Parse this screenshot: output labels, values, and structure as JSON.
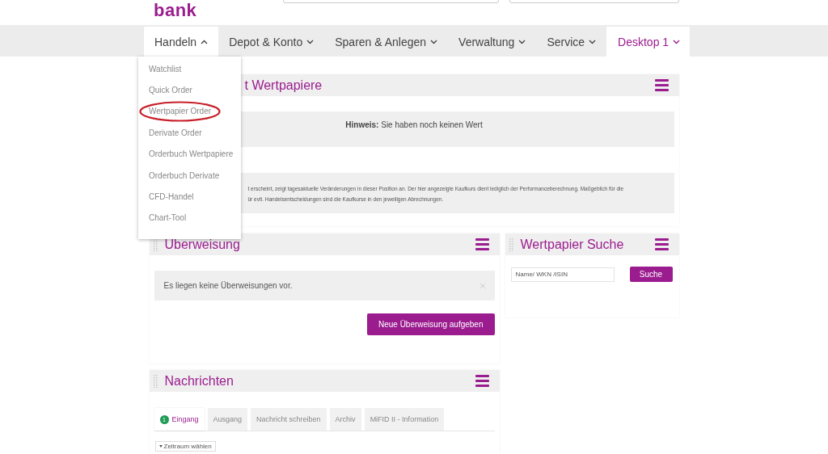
{
  "logo": "bank",
  "nav": {
    "items": [
      {
        "label": "Handeln",
        "selected": true,
        "expanded": true
      },
      {
        "label": "Depot & Konto",
        "selected": false,
        "expanded": false
      },
      {
        "label": "Sparen & Anlegen",
        "selected": false,
        "expanded": false
      },
      {
        "label": "Verwaltung",
        "selected": false,
        "expanded": false
      },
      {
        "label": "Service",
        "selected": false,
        "expanded": false
      }
    ],
    "desktop": "Desktop 1"
  },
  "dropdown": [
    {
      "label": "Watchlist",
      "highlighted": false
    },
    {
      "label": "Quick Order",
      "highlighted": false
    },
    {
      "label": "Wertpapier Order",
      "highlighted": true
    },
    {
      "label": "Derivate Order",
      "highlighted": false
    },
    {
      "label": "Orderbuch Wertpapiere",
      "highlighted": false
    },
    {
      "label": "Orderbuch Derivate",
      "highlighted": false
    },
    {
      "label": "CFD-Handel",
      "highlighted": false
    },
    {
      "label": "Chart-Tool",
      "highlighted": false
    }
  ],
  "portfolio_panel": {
    "title": "t Wertpapiere",
    "hint": "**Hinweis:** Sie haben noch keinen Wert",
    "info_lines": [
      "t erscheint, zeigt tagesaktuelle Veränderungen in dieser Position an. Der hier angezeigte Kaufkurs dient lediglich der Performanceberechnung. Maßgeblich für die",
      "ür evtl. Handelsentscheidungen sind die Kaufkurse in den jeweiligen Abrechnungen."
    ]
  },
  "transfer_panel": {
    "title": "Überweisung",
    "notice": "Es liegen keine Überweisungen vor.",
    "button": "Neue Überweisung aufgeben"
  },
  "search_panel": {
    "title": "Wertpapier Suche",
    "placeholder": "Name/ WKN /ISIN",
    "button": "Suche"
  },
  "messages_panel": {
    "title": "Nachrichten",
    "tabs": [
      {
        "label": "Eingang",
        "selected": true,
        "badge": "1"
      },
      {
        "label": "Ausgang",
        "selected": false
      },
      {
        "label": "Nachricht schreiben",
        "selected": false
      },
      {
        "label": "Archiv",
        "selected": false
      },
      {
        "label": "MiFID II - Information",
        "selected": false
      }
    ],
    "period_button": "Zeitraum wählen"
  }
}
